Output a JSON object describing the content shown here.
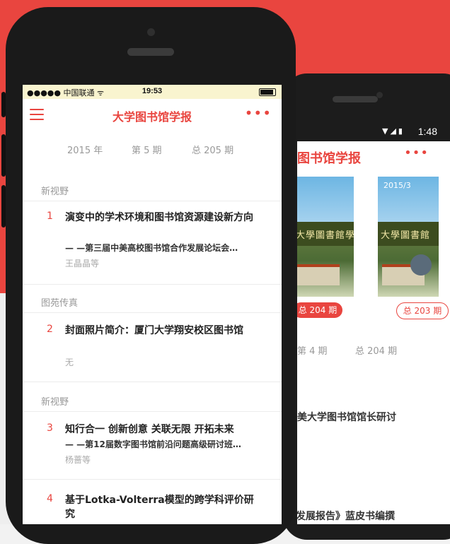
{
  "front": {
    "status": {
      "carrier": "●●●●● 中国联通 ",
      "time": "19:53"
    },
    "nav": {
      "title": "大学图书馆学报",
      "more": "•••"
    },
    "issue": {
      "year": "2015 年",
      "issue_no": "第 5 期",
      "total": "总 205 期"
    },
    "sections": [
      {
        "header": "新视野",
        "articles": [
          {
            "num": "1",
            "title": "演变中的学术环境和图书馆资源建设新方向",
            "subtitle": "— —第三届中美高校图书馆合作发展论坛会…",
            "author": "王晶晶等"
          }
        ]
      },
      {
        "header": "图苑传真",
        "articles": [
          {
            "num": "2",
            "title": "封面照片简介：厦门大学翔安校区图书馆",
            "subtitle": "",
            "author": "无"
          }
        ]
      },
      {
        "header": "新视野",
        "articles": [
          {
            "num": "3",
            "title": "知行合一 创新创意 关联无限 开拓未来",
            "subtitle": "— —第12届数字图书馆前沿问题高级研讨班…",
            "author": "杨蔷等"
          },
          {
            "num": "4",
            "title": "基于Lotka-Volterra模型的跨学科评价研究",
            "subtitle": "",
            "author": ""
          }
        ]
      }
    ]
  },
  "back": {
    "status": {
      "time": "1:48"
    },
    "title": "图书馆学报",
    "more": "•••",
    "covers": [
      {
        "year": "",
        "masthead": "大學圖書館學報",
        "pill": "总 204 期"
      },
      {
        "year": "2015/3",
        "masthead": "大學圖書館",
        "pill": "总 203 期"
      }
    ],
    "issue": {
      "issue_no": "第 4 期",
      "total": "总 204 期"
    },
    "article_line_1": "美大学图书馆馆长研讨",
    "article_line_2": "发展报告》蓝皮书编撰"
  },
  "colors": {
    "accent": "#e9453f",
    "background_top": "#e9453f"
  }
}
